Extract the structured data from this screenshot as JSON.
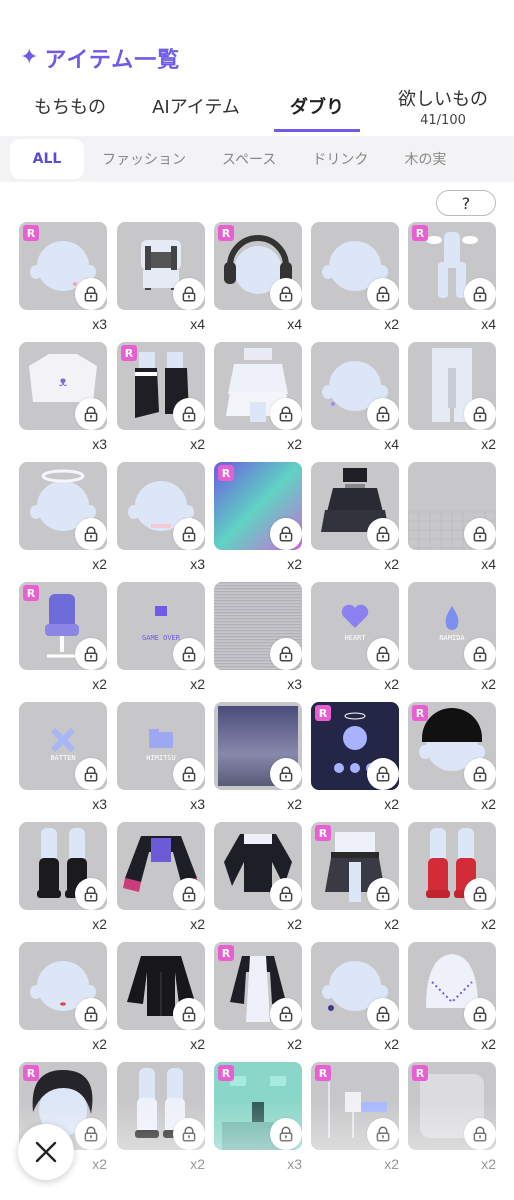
{
  "header": {
    "title": "アイテム一覧",
    "icon": "sparkle-icon",
    "accent": "#6f5be8"
  },
  "tabs": [
    {
      "label": "もちもの",
      "sub": ""
    },
    {
      "label": "AIアイテム",
      "sub": ""
    },
    {
      "label": "ダブり",
      "sub": "",
      "active": true
    },
    {
      "label": "欲しいもの",
      "sub": "41/100"
    }
  ],
  "categories": [
    {
      "label": "ALL",
      "active": true
    },
    {
      "label": "ファッション"
    },
    {
      "label": "スペース"
    },
    {
      "label": "ドリンク"
    },
    {
      "label": "木の実"
    }
  ],
  "help_label": "?",
  "items": [
    {
      "count": "x3",
      "rare": true,
      "art": "face-blue"
    },
    {
      "count": "x4",
      "rare": false,
      "art": "overalls"
    },
    {
      "count": "x4",
      "rare": true,
      "art": "headphones"
    },
    {
      "count": "x2",
      "rare": false,
      "art": "face"
    },
    {
      "count": "x4",
      "rare": true,
      "art": "wings-suit"
    },
    {
      "count": "x3",
      "rare": false,
      "art": "bunny-shirt"
    },
    {
      "count": "x2",
      "rare": true,
      "art": "black-boots"
    },
    {
      "count": "x2",
      "rare": false,
      "art": "ruffle-skirt"
    },
    {
      "count": "x4",
      "rare": false,
      "art": "face-earring"
    },
    {
      "count": "x2",
      "rare": false,
      "art": "pants"
    },
    {
      "count": "x2",
      "rare": false,
      "art": "halo"
    },
    {
      "count": "x3",
      "rare": false,
      "art": "face-choker"
    },
    {
      "count": "x2",
      "rare": true,
      "art": "holo-bg"
    },
    {
      "count": "x2",
      "rare": false,
      "art": "tiered-skirt"
    },
    {
      "count": "x4",
      "rare": false,
      "art": "grid-floor"
    },
    {
      "count": "x2",
      "rare": true,
      "art": "chair"
    },
    {
      "count": "x2",
      "rare": false,
      "art": "game-over",
      "text": "GAME OVER"
    },
    {
      "count": "x3",
      "rare": false,
      "art": "stripes"
    },
    {
      "count": "x2",
      "rare": false,
      "art": "heart-sign",
      "text": "HEART"
    },
    {
      "count": "x2",
      "rare": false,
      "art": "drop-sign",
      "text": "NAMIDA"
    },
    {
      "count": "x3",
      "rare": false,
      "art": "batten-sign",
      "text": "BATTEN"
    },
    {
      "count": "x3",
      "rare": false,
      "art": "folder-sign",
      "text": "HIMITSU"
    },
    {
      "count": "x2",
      "rare": false,
      "art": "dark-gradient"
    },
    {
      "count": "x2",
      "rare": true,
      "art": "bunny-poster"
    },
    {
      "count": "x2",
      "rare": true,
      "art": "black-hat"
    },
    {
      "count": "x2",
      "rare": false,
      "art": "black-socks"
    },
    {
      "count": "x2",
      "rare": false,
      "art": "crop-jacket"
    },
    {
      "count": "x2",
      "rare": false,
      "art": "black-top"
    },
    {
      "count": "x2",
      "rare": true,
      "art": "skirt-belt"
    },
    {
      "count": "x2",
      "rare": false,
      "art": "red-socks"
    },
    {
      "count": "x2",
      "rare": false,
      "art": "face-lips"
    },
    {
      "count": "x2",
      "rare": false,
      "art": "black-jacket"
    },
    {
      "count": "x2",
      "rare": true,
      "art": "coat"
    },
    {
      "count": "x2",
      "rare": false,
      "art": "face-earring2"
    },
    {
      "count": "x2",
      "rare": false,
      "art": "beanie"
    },
    {
      "count": "x2",
      "rare": true,
      "art": "black-hair"
    },
    {
      "count": "x2",
      "rare": false,
      "art": "sneakers"
    },
    {
      "count": "x3",
      "rare": true,
      "art": "room"
    },
    {
      "count": "x2",
      "rare": true,
      "art": "hospital"
    },
    {
      "count": "x2",
      "rare": true,
      "art": "blur"
    }
  ],
  "close_label": "close",
  "colors": {
    "rare_badge": "#e85fd2",
    "tile_bg": "#c7c7c9",
    "body_blue": "#dde6f7"
  }
}
